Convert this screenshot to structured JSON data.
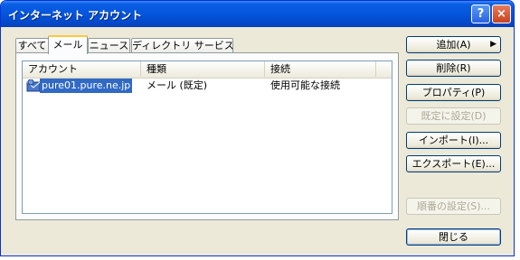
{
  "window": {
    "title": "インターネット アカウント"
  },
  "titlebar": {
    "help_label": "?",
    "close_label": "×"
  },
  "tabs": [
    {
      "label": "すべて"
    },
    {
      "label": "メール"
    },
    {
      "label": "ニュース"
    },
    {
      "label": "ディレクトリ サービス"
    }
  ],
  "list": {
    "columns": [
      "アカウント",
      "種類",
      "接続"
    ],
    "rows": [
      {
        "account": "pure01.pure.ne.jp",
        "type": "メール (既定)",
        "connection": "使用可能な接続"
      }
    ]
  },
  "buttons": {
    "add": "追加(A)",
    "remove": "削除(R)",
    "properties": "プロパティ(P)",
    "set_default": "既定に設定(D)",
    "import": "インポート(I)...",
    "export": "エクスポート(E)...",
    "set_order": "順番の設定(S)...",
    "close": "閉じる"
  },
  "selected_tab": "メール",
  "colors": {
    "titlebar": "#0455dc",
    "selection": "#316ac5",
    "window_bg": "#ece9d8"
  }
}
